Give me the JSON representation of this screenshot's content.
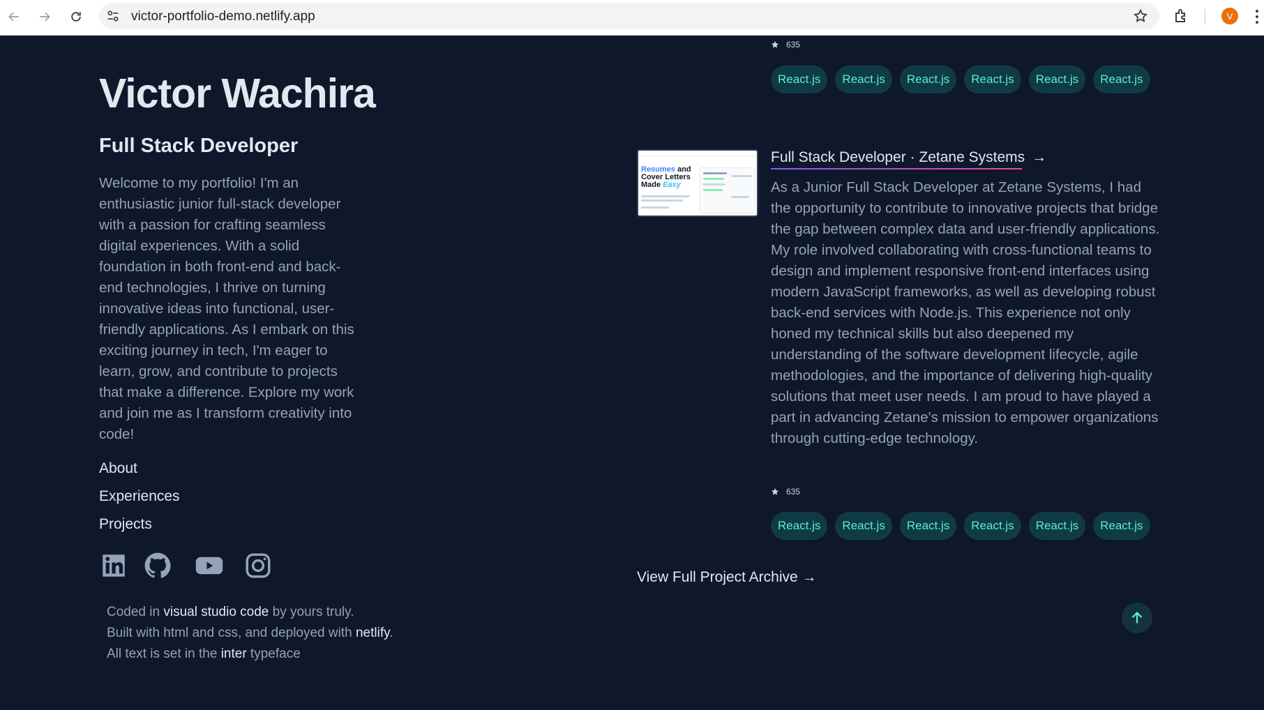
{
  "browser": {
    "url": "victor-portfolio-demo.netlify.app",
    "avatar_initial": "V",
    "icons": [
      "back-arrow-icon",
      "forward-arrow-icon",
      "reload-icon",
      "site-info-icon",
      "bookmark-star-icon",
      "extensions-icon",
      "kebab-menu-icon"
    ]
  },
  "profile": {
    "name": "Victor Wachira",
    "role": "Full Stack Developer",
    "intro": "Welcome to my portfolio! I'm an enthusiastic junior full-stack developer with a passion for crafting seamless digital experiences. With a solid foundation in both front-end and back-end technologies, I thrive on turning innovative ideas into functional, user-friendly applications. As I embark on this exciting journey in tech, I'm eager to learn, grow, and contribute to projects that make a difference. Explore my work and join me as I transform creativity into code!"
  },
  "nav": [
    {
      "label": "About"
    },
    {
      "label": "Experiences"
    },
    {
      "label": "Projects"
    }
  ],
  "social": [
    "linkedin-icon",
    "github-icon",
    "youtube-icon",
    "instagram-icon"
  ],
  "footer": {
    "line1": {
      "a": "Coded in ",
      "b": "visual studio code",
      "c": " by yours truly."
    },
    "line2": {
      "a": "Built with html and css, and deployed with ",
      "b": "netlify",
      "c": "."
    },
    "line3": {
      "a": "All text is set in the ",
      "b": "inter",
      "c": " typeface"
    }
  },
  "top_card": {
    "stars": "635",
    "tags": [
      "React.js",
      "React.js",
      "React.js",
      "React.js",
      "React.js",
      "React.js"
    ]
  },
  "experience": {
    "thumb_text": {
      "w1": "Resumes",
      "w2": " and",
      "w3": "Cover Letters",
      "w4": "Made ",
      "w5": "Easy"
    },
    "title": "Full Stack Developer · Zetane Systems",
    "arrow": "→",
    "description": "As a Junior Full Stack Developer at Zetane Systems, I had the opportunity to contribute to innovative projects that bridge the gap between complex data and user-friendly applications. My role involved collaborating with cross-functional teams to design and implement responsive front-end interfaces using modern JavaScript frameworks, as well as developing robust back-end services with Node.js. This experience not only honed my technical skills but also deepened my understanding of the software development lifecycle, agile methodologies, and the importance of delivering high-quality solutions that meet user needs. I am proud to have played a part in advancing Zetane's mission to empower organizations through cutting-edge technology.",
    "stars": "635",
    "tags": [
      "React.js",
      "React.js",
      "React.js",
      "React.js",
      "React.js",
      "React.js"
    ]
  },
  "archive_link": "View Full Project Archive →",
  "colors": {
    "background": "#0f172a",
    "accent": "#5eead4",
    "tag_bg": "#0f3b44",
    "heading": "#e2e8f0",
    "body_text": "#94a3b8"
  }
}
